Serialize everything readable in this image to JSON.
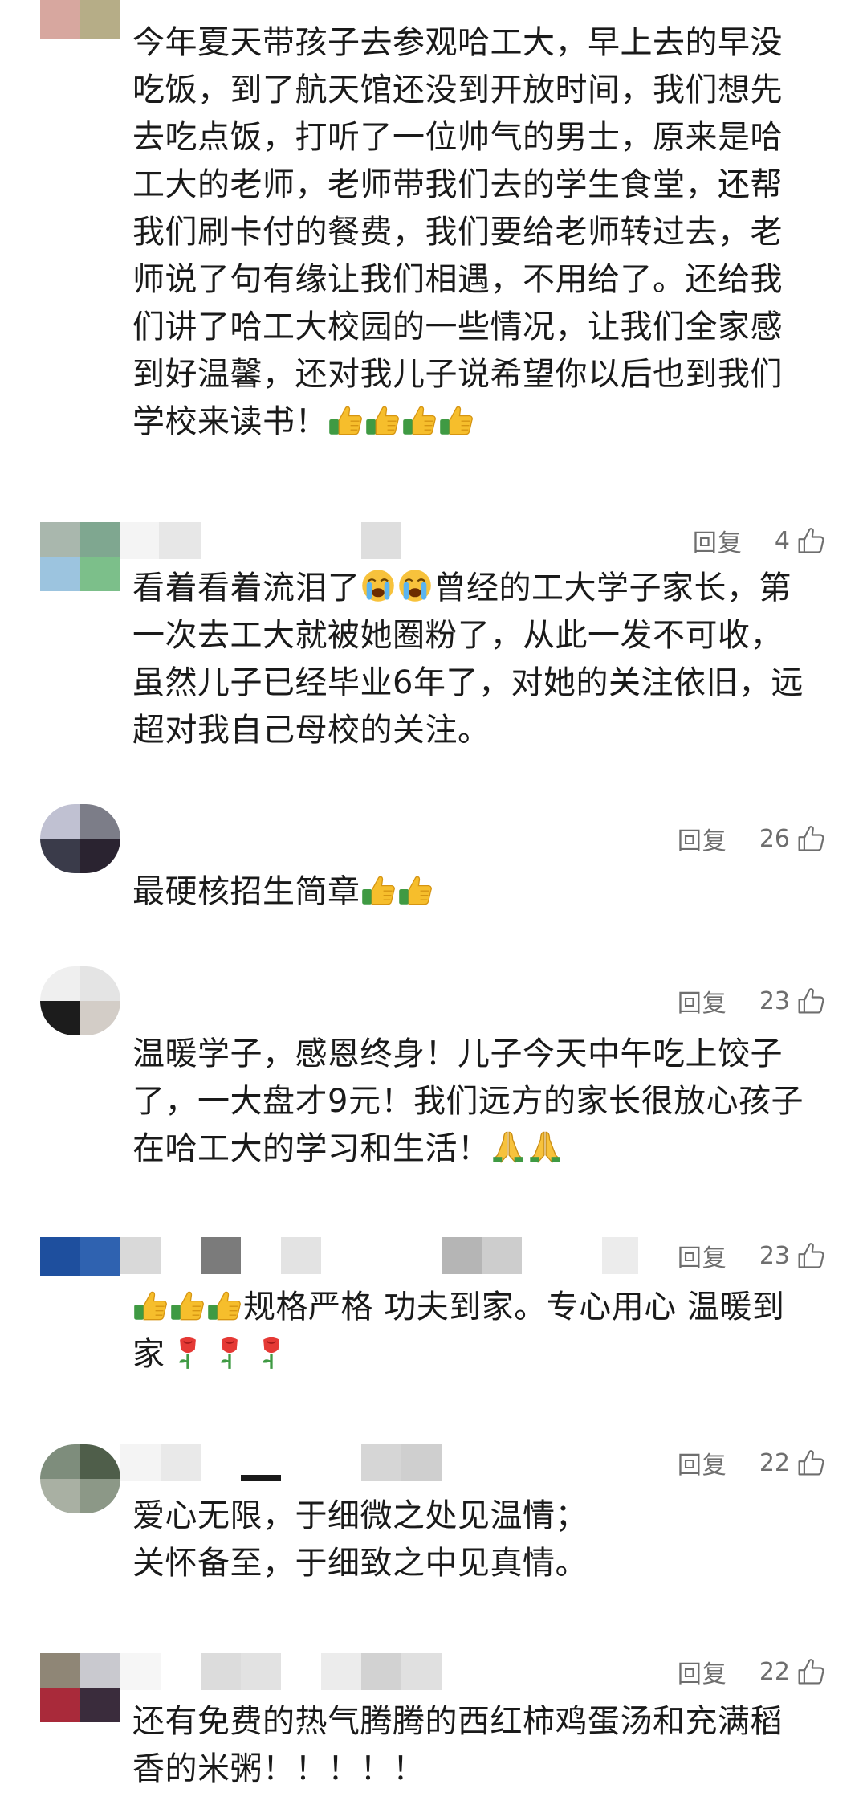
{
  "comments": [
    {
      "lines": [
        "今年夏天带孩子去参观哈工大，早上去的早没",
        "吃饭，到了航天馆还没到开放时间，我们想先",
        "去吃点饭，打听了一位帅气的男士，原来是哈",
        "工大的老师，老师带我们去的学生食堂，还帮",
        "我们刷卡付的餐费，我们要给老师转过去，老",
        "师说了句有缘让我们相遇，不用给了。还给我",
        "们讲了哈工大校园的一些情况，让我们全家感",
        "到好温馨，还对我儿子说希望你以后也到我们",
        "学校来读书！"
      ],
      "trailing_emoji": [
        "thumbs-up",
        "thumbs-up",
        "thumbs-up",
        "thumbs-up"
      ]
    },
    {
      "reply_label": "回复",
      "likes": "4",
      "lines": [
        "看着看着流泪了",
        "一次去工大就被她圈粉了，从此一发不可收，",
        "虽然儿子已经毕业6年了，对她的关注依旧，远",
        "超对我自己母校的关注。"
      ],
      "inline_after_line1": "曾经的工大学子家长，第",
      "inline_emoji": [
        "crying-face",
        "crying-face"
      ]
    },
    {
      "reply_label": "回复",
      "likes": "26",
      "lines": [
        "最硬核招生简章"
      ],
      "trailing_emoji": [
        "thumbs-up",
        "thumbs-up"
      ]
    },
    {
      "reply_label": "回复",
      "likes": "23",
      "lines": [
        "温暖学子，感恩终身！儿子今天中午吃上饺子",
        "了，一大盘才9元！我们远方的家长很放心孩子",
        "在哈工大的学习和生活！"
      ],
      "trailing_emoji": [
        "folded-hands",
        "folded-hands"
      ]
    },
    {
      "reply_label": "回复",
      "likes": "23",
      "lines": [
        "规格严格 功夫到家。专心用心 温暖到",
        "家"
      ],
      "leading_emoji": [
        "thumbs-up",
        "thumbs-up",
        "thumbs-up"
      ],
      "trailing_emoji": [
        "rose",
        "rose",
        "rose"
      ]
    },
    {
      "reply_label": "回复",
      "likes": "22",
      "lines": [
        "爱心无限，于细微之处见温情；",
        "关怀备至，于细致之中见真情。"
      ]
    },
    {
      "reply_label": "回复",
      "likes": "22",
      "lines": [
        "还有免费的热气腾腾的西红柿鸡蛋汤和充满稻",
        "香的米粥！！！！！"
      ]
    }
  ],
  "icons": {
    "like": "thumbs-up-outline-icon"
  },
  "colors": {
    "meta_text": "#6e6e6e",
    "body_text": "#1a1a1a",
    "emoji_yellow": "#f7c23c",
    "emoji_green": "#4caf50"
  }
}
